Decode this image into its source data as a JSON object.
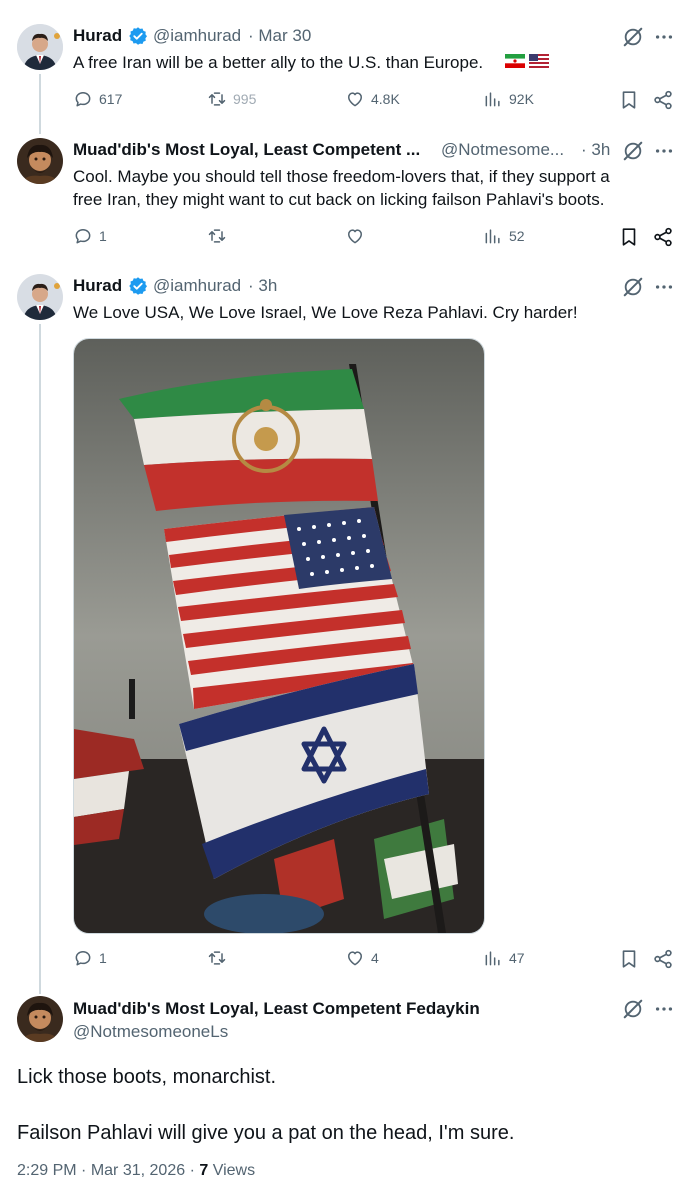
{
  "tweet1": {
    "name": "Hurad",
    "handle": "@iamhurad",
    "time": "· Mar 30",
    "text": "A free Iran will be a better ally to the U.S. than Europe.",
    "replies": "617",
    "retweets": "995",
    "likes": "4.8K",
    "views": "92K"
  },
  "tweet2": {
    "name": "Muad'dib's Most Loyal, Least Competent ...",
    "handle": "@Notmesome...",
    "time": "· 3h",
    "text_line1": "Cool. Maybe you should tell those freedom-lovers that, if they support a",
    "text_line2": "free Iran, they might want to cut back on licking failson Pahlavi's boots.",
    "replies": "1",
    "views": "52"
  },
  "tweet3": {
    "name": "Hurad",
    "handle": "@iamhurad",
    "time": "· 3h",
    "text": "We Love USA, We Love Israel, We Love Reza Pahlavi. Cry harder!",
    "replies": "1",
    "likes": "4",
    "views": "47"
  },
  "main": {
    "name": "Muad'dib's Most Loyal, Least Competent Fedaykin",
    "handle": "@NotmesomeoneLs",
    "text_line1": "Lick those boots, monarchist.",
    "text_line2": "Failson Pahlavi will give you a pat on the head, I'm sure.",
    "time": "2:29 PM",
    "date": "Mar 31, 2026",
    "views_count": "7",
    "views_label": "Views"
  },
  "icons": {
    "verified": "verified-badge-icon",
    "grok": "grok-icon",
    "more": "more-icon",
    "reply": "reply-icon",
    "retweet": "retweet-icon",
    "like": "like-icon",
    "views": "views-icon",
    "bookmark": "bookmark-icon",
    "share": "share-icon"
  },
  "colors": {
    "verified": "#1d9bf0",
    "secondary_text": "#536471",
    "thread_line": "#cfd9de"
  }
}
